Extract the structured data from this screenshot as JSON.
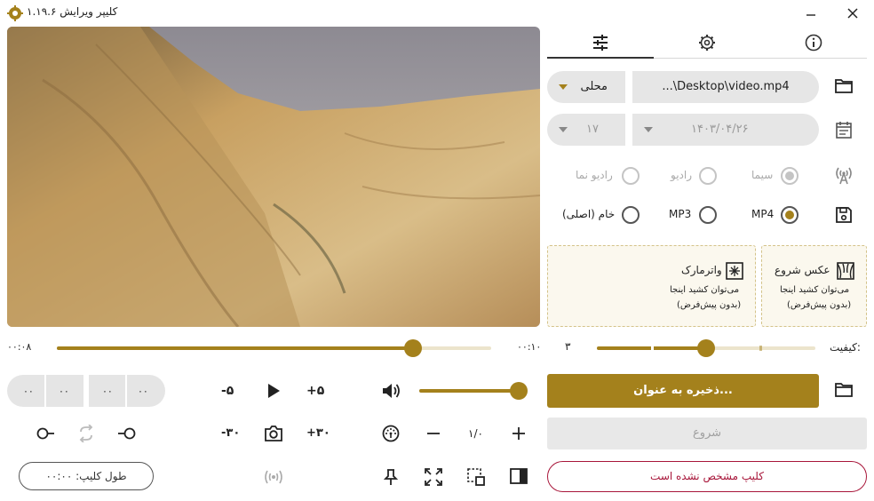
{
  "window": {
    "title": "کلیپر ویرایش ۱.۱۹.۶",
    "logo_icon": "gear-logo-icon",
    "minimize_icon": "minimize-icon",
    "close_icon": "close-icon"
  },
  "tabs": [
    {
      "icon": "sliders-icon",
      "active": true
    },
    {
      "icon": "gear-icon",
      "active": false
    },
    {
      "icon": "info-icon",
      "active": false
    }
  ],
  "source": {
    "folder_icon": "folder-icon",
    "path": "...\\Desktop\\video.mp4",
    "location_label": "محلی"
  },
  "date": {
    "calendar_icon": "calendar-icon",
    "value": "۱۴۰۳/۰۴/۲۶",
    "hour": "۱۷"
  },
  "broadcast": {
    "icon": "antenna-icon",
    "options": [
      "سیما",
      "رادیو",
      "رادیو نما"
    ],
    "selected": "سیما"
  },
  "format": {
    "icon": "save-icon",
    "options": [
      "MP4",
      "MP3",
      "خام (اصلی)"
    ],
    "selected": "MP4"
  },
  "drop_start": {
    "title": "عکس شروع",
    "hint": "می‌توان کشید اینجا",
    "default": "(بدون پیش‌فرض)"
  },
  "drop_watermark": {
    "title": "واترمارک",
    "hint": "می‌توان کشید اینجا",
    "default": "(بدون پیش‌فرض)"
  },
  "timeline": {
    "end_time": "۰۰:۱۰",
    "start_time": "۰۰:۰۸",
    "position": 0.82
  },
  "quality": {
    "label": "کیفیت:",
    "value": "۳",
    "level": 0.5
  },
  "save_as_label": "ذخیره به عنوان...",
  "start_label": "شروع",
  "clip_status": "کلیپ مشخص نشده است",
  "clip_length_label": "طول کلیپ: ۰۰:۰۰",
  "speed_value": "۱/۰",
  "volume_level": 1.0,
  "time_segments": [
    "۰۰",
    "۰۰",
    "۰۰",
    "۰۰"
  ],
  "transport": {
    "back5": "-۵",
    "fwd5": "+۵",
    "back30": "-۳۰",
    "fwd30": "+۳۰"
  },
  "colors": {
    "accent": "#a4811c",
    "warning": "#a8163a",
    "pill": "#e6e6e6"
  }
}
